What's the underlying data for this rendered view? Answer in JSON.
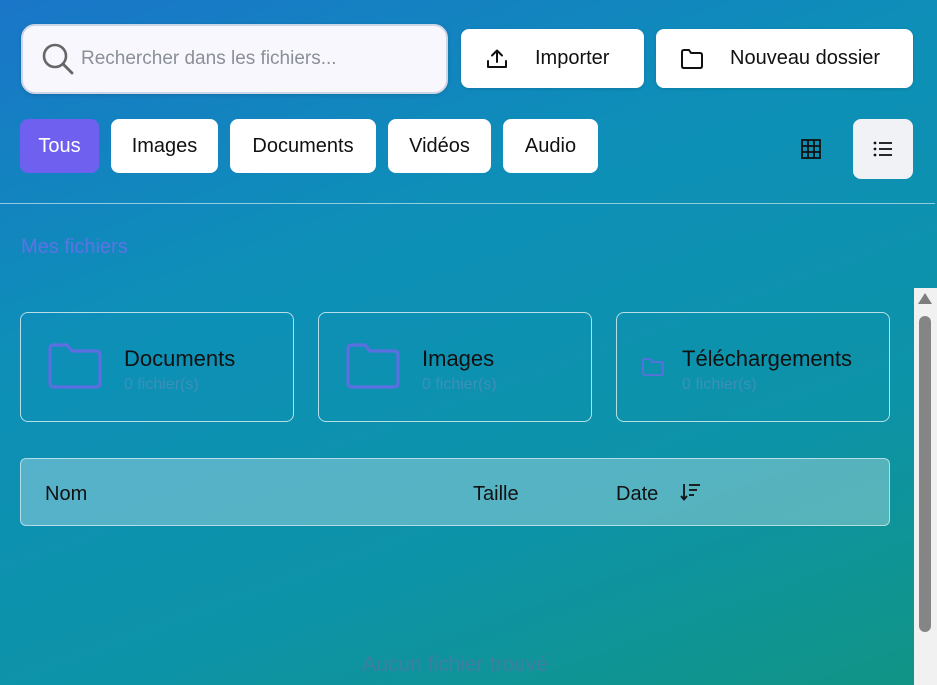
{
  "search": {
    "placeholder": "Rechercher dans les fichiers...",
    "value": ""
  },
  "toolbar": {
    "import_label": "Importer",
    "new_folder_label": "Nouveau dossier"
  },
  "filters": [
    {
      "label": "Tous",
      "active": true
    },
    {
      "label": "Images",
      "active": false
    },
    {
      "label": "Documents",
      "active": false
    },
    {
      "label": "Vidéos",
      "active": false
    },
    {
      "label": "Audio",
      "active": false
    }
  ],
  "view": {
    "mode": "list",
    "grid_icon": "grid-icon",
    "list_icon": "list-icon"
  },
  "section": {
    "title": "Mes fichiers"
  },
  "folders": [
    {
      "name": "Documents",
      "count": "0 fichier(s)"
    },
    {
      "name": "Images",
      "count": "0 fichier(s)"
    },
    {
      "name": "Téléchargements",
      "count": "0 fichier(s)"
    }
  ],
  "table": {
    "col_name": "Nom",
    "col_size": "Taille",
    "col_date": "Date",
    "sort_icon": "sort-descending-icon"
  },
  "empty_state": {
    "message": "Aucun fichier trouvé"
  },
  "colors": {
    "accent": "#6f60ef",
    "folder_icon": "#5b6fe0"
  }
}
